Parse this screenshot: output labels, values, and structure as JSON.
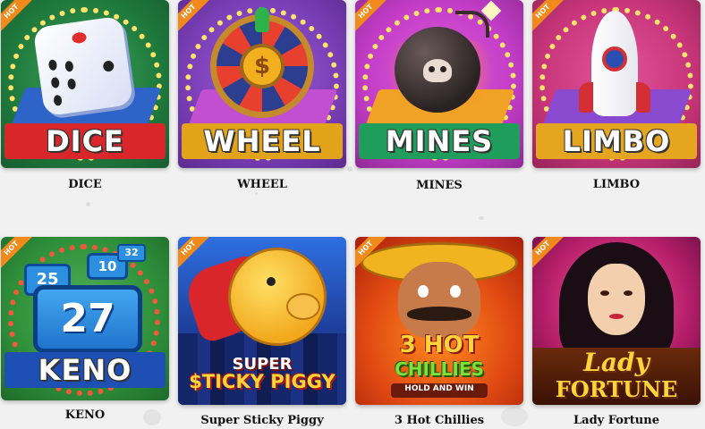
{
  "games": [
    {
      "title": "DICE",
      "logo": "DICE",
      "hot_badge": "HOT",
      "icon": "dice-icon"
    },
    {
      "title": "WHEEL",
      "logo": "WHEEL",
      "hot_badge": "HOT",
      "icon": "dollar-wheel-icon"
    },
    {
      "title": "MINES",
      "logo": "MINES",
      "hot_badge": "HOT",
      "icon": "bomb-icon"
    },
    {
      "title": "LIMBO",
      "logo": "LIMBO",
      "hot_badge": "HOT",
      "icon": "rocket-icon"
    },
    {
      "title": "KENO",
      "logo": "KENO",
      "hot_badge": "HOT",
      "icon": "keno-balls-icon",
      "numbers": [
        "25",
        "10",
        "32",
        "27"
      ]
    },
    {
      "title": "Super Sticky Piggy",
      "logo_top": "SUPER",
      "logo_bottom": "$TICKY PIGGY",
      "hot_badge": "HOT",
      "icon": "flying-pig-icon"
    },
    {
      "title": "3 Hot Chillies",
      "logo_top": "3 HOT",
      "logo_mid": "CHILLIES",
      "logo_bottom": "HOLD AND WIN",
      "hot_badge": "HOT",
      "icon": "sombrero-man-icon"
    },
    {
      "title": "Lady Fortune",
      "logo_top": "Lady",
      "logo_bottom": "FORTUNE",
      "hot_badge": "HOT",
      "icon": "lady-portrait-icon"
    }
  ],
  "colors": {
    "dice_bg": "#1f7a3d",
    "wheel_bg": "#7a3fb6",
    "mines_bg": "#c23cc6",
    "limbo_bg": "#c8357a",
    "keno_bg": "#2f8f3a",
    "hot_badge": "#f28a1b"
  }
}
